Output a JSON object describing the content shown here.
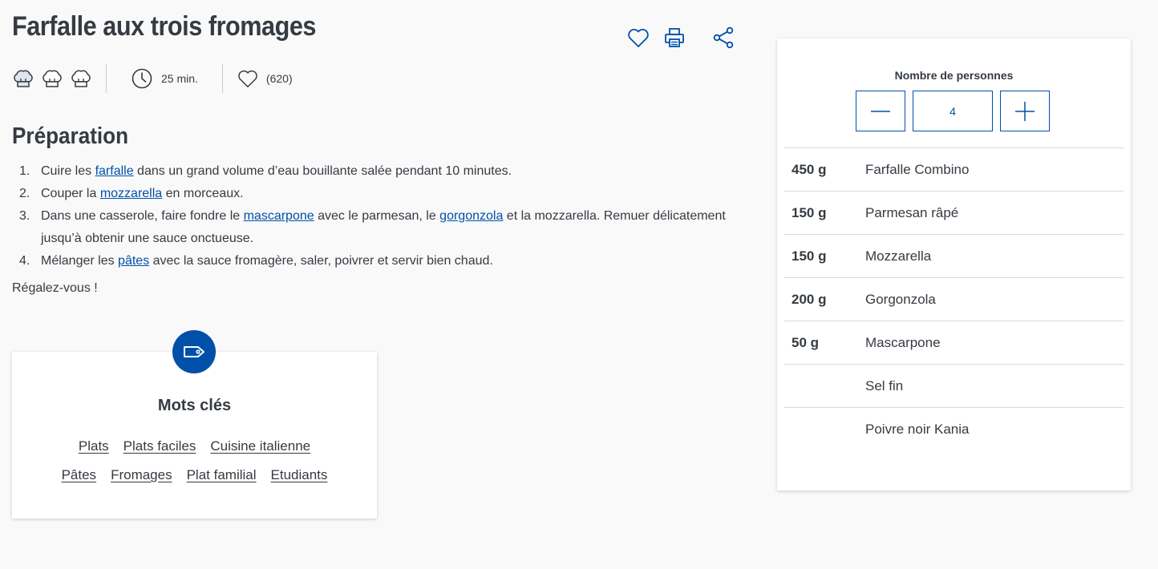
{
  "recipe": {
    "title": "Farfalle aux trois fromages",
    "time": "25 min.",
    "likes": "(620)",
    "difficulty_hats": 3
  },
  "actions": {
    "favorite_icon": "heart-icon",
    "print_icon": "printer-icon",
    "share_icon": "share-icon"
  },
  "preparation": {
    "title": "Préparation",
    "steps": [
      {
        "num": "1.",
        "parts": [
          "Cuire les ",
          "farfalle",
          " dans un grand volume d’eau bouillante salée pendant 10 minutes."
        ]
      },
      {
        "num": "2.",
        "parts": [
          "Couper la ",
          "mozzarella",
          " en morceaux."
        ]
      },
      {
        "num": "3.",
        "parts": [
          "Dans une casserole, faire fondre le ",
          "mascarpone",
          " avec le parmesan, le ",
          "gorgonzola",
          " et la mozzarella. Remuer délicatement jusqu’à obtenir une sauce onctueuse."
        ]
      },
      {
        "num": "4.",
        "parts": [
          "Mélanger les ",
          "pâtes",
          " avec la sauce fromagère, saler, poivrer et servir bien chaud."
        ]
      }
    ],
    "closing": "Régalez-vous !"
  },
  "keywords": {
    "title": "Mots clés",
    "row1": [
      "Plats",
      "Plats faciles",
      "Cuisine italienne"
    ],
    "row2": [
      "Pâtes",
      "Fromages",
      "Plat familial",
      "Etudiants"
    ]
  },
  "servings": {
    "label": "Nombre de personnes",
    "value": "4"
  },
  "ingredients": [
    {
      "qty": "450 g",
      "name": "Farfalle  Combino"
    },
    {
      "qty": "150 g",
      "name": "Parmesan râpé"
    },
    {
      "qty": "150 g",
      "name": "Mozzarella"
    },
    {
      "qty": "200 g",
      "name": "Gorgonzola"
    },
    {
      "qty": "50 g",
      "name": "Mascarpone"
    },
    {
      "qty": "",
      "name": "Sel fin"
    },
    {
      "qty": "",
      "name": "Poivre noir  Kania"
    }
  ],
  "colors": {
    "accent": "#0050aa",
    "text": "#353b42",
    "background": "#f9f9f9"
  }
}
